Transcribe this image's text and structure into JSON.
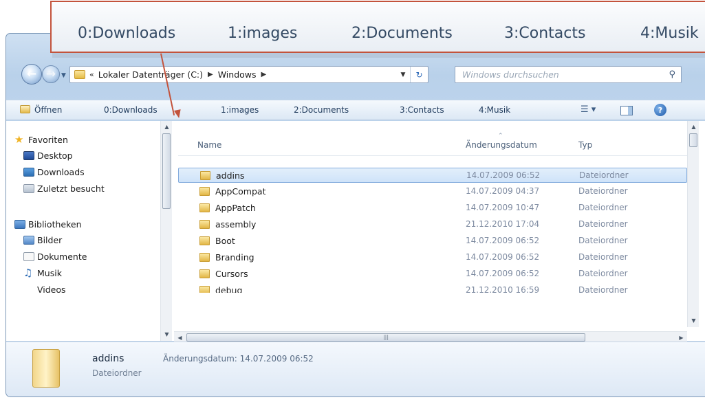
{
  "callout": {
    "items": [
      "0:Downloads",
      "1:images",
      "2:Documents",
      "3:Contacts",
      "4:Musik"
    ]
  },
  "address": {
    "crumbs": [
      "Lokaler Datenträger (C:)",
      "Windows"
    ],
    "overflow_glyph": "«",
    "search_placeholder": "Windows durchsuchen"
  },
  "toolbar": {
    "open_label": "Öffnen",
    "library_links": [
      "0:Downloads",
      "1:images",
      "2:Documents",
      "3:Contacts",
      "4:Musik"
    ]
  },
  "nav_pane": {
    "favorites_label": "Favoriten",
    "favorites": [
      "Desktop",
      "Downloads",
      "Zuletzt besucht"
    ],
    "libraries_label": "Bibliotheken",
    "libraries": [
      "Bilder",
      "Dokumente",
      "Musik",
      "Videos"
    ]
  },
  "file_list": {
    "columns": [
      "Name",
      "Änderungsdatum",
      "Typ"
    ],
    "rows": [
      {
        "name": "addins",
        "date": "14.07.2009 06:52",
        "type": "Dateiordner",
        "selected": true
      },
      {
        "name": "AppCompat",
        "date": "14.07.2009 04:37",
        "type": "Dateiordner",
        "selected": false
      },
      {
        "name": "AppPatch",
        "date": "14.07.2009 10:47",
        "type": "Dateiordner",
        "selected": false
      },
      {
        "name": "assembly",
        "date": "21.12.2010 17:04",
        "type": "Dateiordner",
        "selected": false
      },
      {
        "name": "Boot",
        "date": "14.07.2009 06:52",
        "type": "Dateiordner",
        "selected": false
      },
      {
        "name": "Branding",
        "date": "14.07.2009 06:52",
        "type": "Dateiordner",
        "selected": false
      },
      {
        "name": "Cursors",
        "date": "14.07.2009 06:52",
        "type": "Dateiordner",
        "selected": false
      },
      {
        "name": "debug",
        "date": "21.12.2010 16:59",
        "type": "Dateiordner",
        "selected": false
      }
    ]
  },
  "details": {
    "name": "addins",
    "type": "Dateiordner",
    "date_label": "Änderungsdatum:",
    "date_value": "14.07.2009 06:52"
  },
  "colors": {
    "callout_border": "#c3533c",
    "selection": "#cfe3f9",
    "window_chrome": "#b9d1ea"
  },
  "icons": {
    "back": "back-arrow-icon",
    "forward": "forward-arrow-icon",
    "search": "search-icon",
    "views": "views-icon",
    "preview": "preview-pane-icon",
    "help": "help-icon",
    "folder": "folder-icon"
  }
}
